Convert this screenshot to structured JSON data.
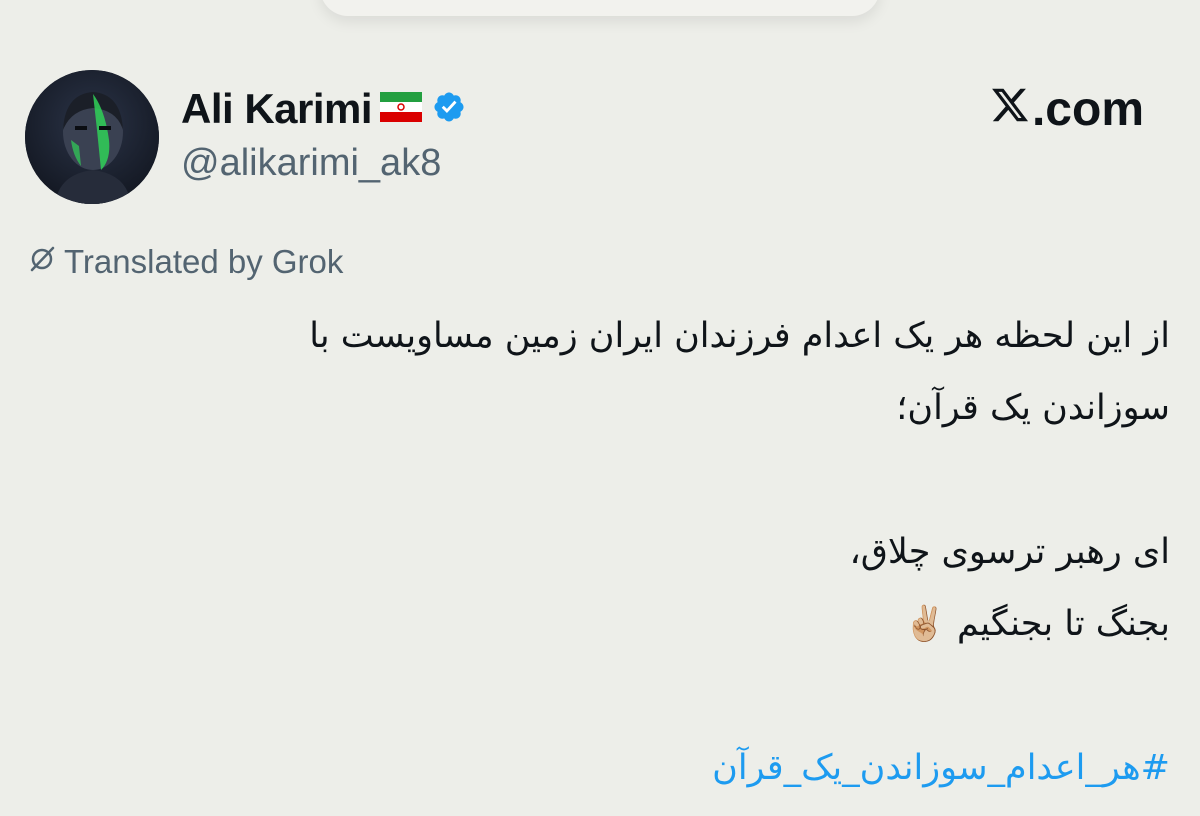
{
  "author": {
    "display_name": "Ali Karimi",
    "flag_icon": "iran-flag-icon",
    "verified_icon": "verified-badge-icon",
    "handle": "@alikarimi_ak8"
  },
  "brand": {
    "logo": "X",
    "suffix": ".com"
  },
  "translation": {
    "icon": "grok-icon",
    "label": "Translated by Grok"
  },
  "tweet": {
    "line1": "از این لحظه هر یک اعدام فرزندان ایران زمین مساویست با",
    "line2": "سوزاندن یک قرآن؛",
    "line3": "ای رهبر ترسوی چلاق،",
    "line4": "بجنگ تا بجنگیم",
    "line4_emoji": "✌🏼",
    "hashtag": "#هر_اعدام_سوزاندن_یک_قرآن"
  },
  "colors": {
    "background": "#edeee9",
    "text": "#0f1419",
    "secondary": "#536471",
    "link": "#1d9bf0",
    "verified": "#1d9bf0"
  }
}
